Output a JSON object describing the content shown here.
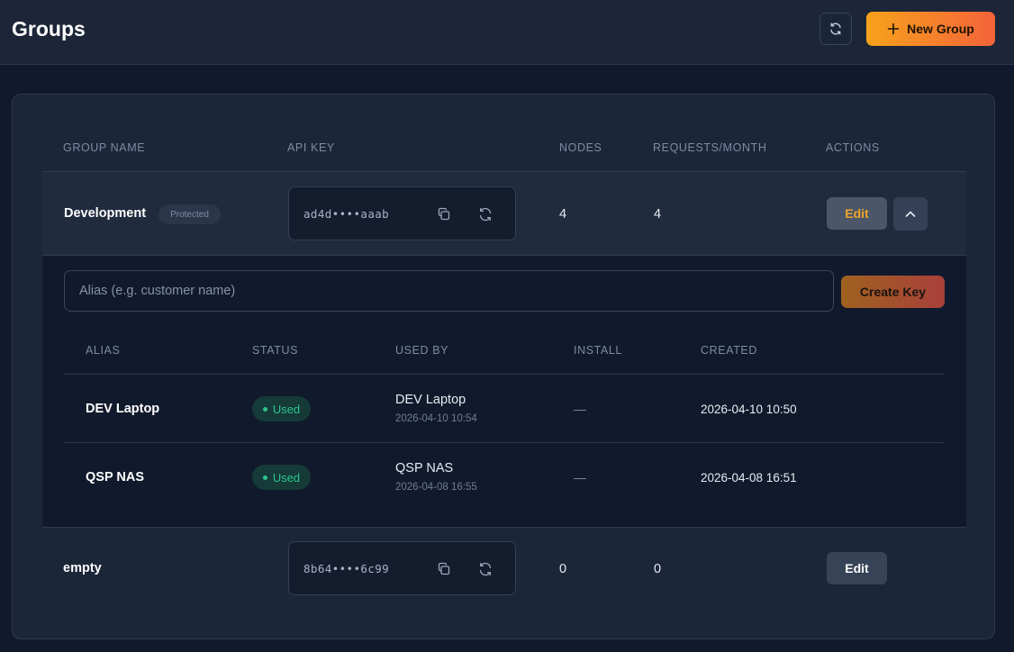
{
  "header": {
    "title": "Groups",
    "new_group_label": "New Group"
  },
  "table": {
    "columns": [
      "GROUP NAME",
      "API KEY",
      "NODES",
      "REQUESTS/MONTH",
      "ACTIONS"
    ],
    "groups": [
      {
        "name": "Development",
        "badge": "Protected",
        "api_key": "ad4d••••aaab",
        "nodes": "4",
        "requests": "4",
        "edit_label": "Edit",
        "expanded": true
      },
      {
        "name": "empty",
        "api_key": "8b64••••6c99",
        "nodes": "0",
        "requests": "0",
        "edit_label": "Edit"
      }
    ]
  },
  "keys_panel": {
    "alias_placeholder": "Alias (e.g. customer name)",
    "alias_value": "",
    "create_key_label": "Create Key",
    "columns": [
      "ALIAS",
      "STATUS",
      "USED BY",
      "INSTALL",
      "CREATED"
    ],
    "rows": [
      {
        "alias": "DEV Laptop",
        "status": "Used",
        "used_by": "DEV Laptop",
        "used_by_date": "2026-04-10 10:54",
        "install": "—",
        "created": "2026-04-10 10:50"
      },
      {
        "alias": "QSP NAS",
        "status": "Used",
        "used_by": "QSP NAS",
        "used_by_date": "2026-04-08 16:55",
        "install": "—",
        "created": "2026-04-08 16:51"
      }
    ]
  },
  "icons": {
    "refresh": "refresh-icon",
    "plus": "plus-icon",
    "copy": "copy-icon",
    "regenerate": "regenerate-icon",
    "collapse": "chevron-up-icon"
  },
  "colors": {
    "accent_start": "#f7a21b",
    "accent_end": "#f4633a",
    "used_green": "#2cc58e",
    "edit_accent": "#f0a429"
  }
}
